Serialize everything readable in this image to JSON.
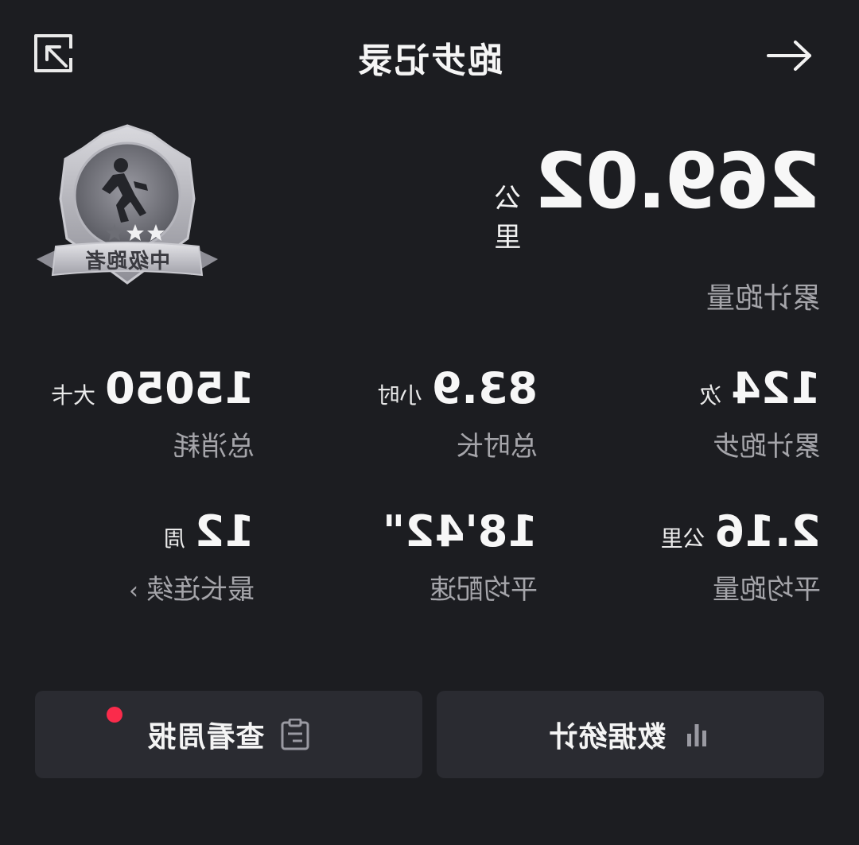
{
  "header": {
    "title": "跑步记录"
  },
  "total_distance": {
    "value": "269.02",
    "unit": "公里",
    "label": "累计跑量"
  },
  "badge": {
    "label": "中级跑者",
    "stars": 2,
    "max_stars": 3
  },
  "stats": [
    {
      "value": "124",
      "unit": "次",
      "label": "累计跑步"
    },
    {
      "value": "83.9",
      "unit": "小时",
      "label": "总时长"
    },
    {
      "value": "15050",
      "unit": "大卡",
      "label": "总消耗"
    },
    {
      "value": "2.16",
      "unit": "公里",
      "label": "平均跑量"
    },
    {
      "value": "18'42\"",
      "unit": "",
      "label": "平均配速"
    },
    {
      "value": "12",
      "unit": "周",
      "label": "最长连续",
      "chevron": "›"
    }
  ],
  "buttons": {
    "stats_label": "数据统计",
    "weekly_label": "查看周报"
  },
  "colors": {
    "background": "#1c1d21",
    "card": "#2a2b31",
    "secondary_text": "#a5a5aa",
    "notification_dot": "#fa2b4b"
  }
}
